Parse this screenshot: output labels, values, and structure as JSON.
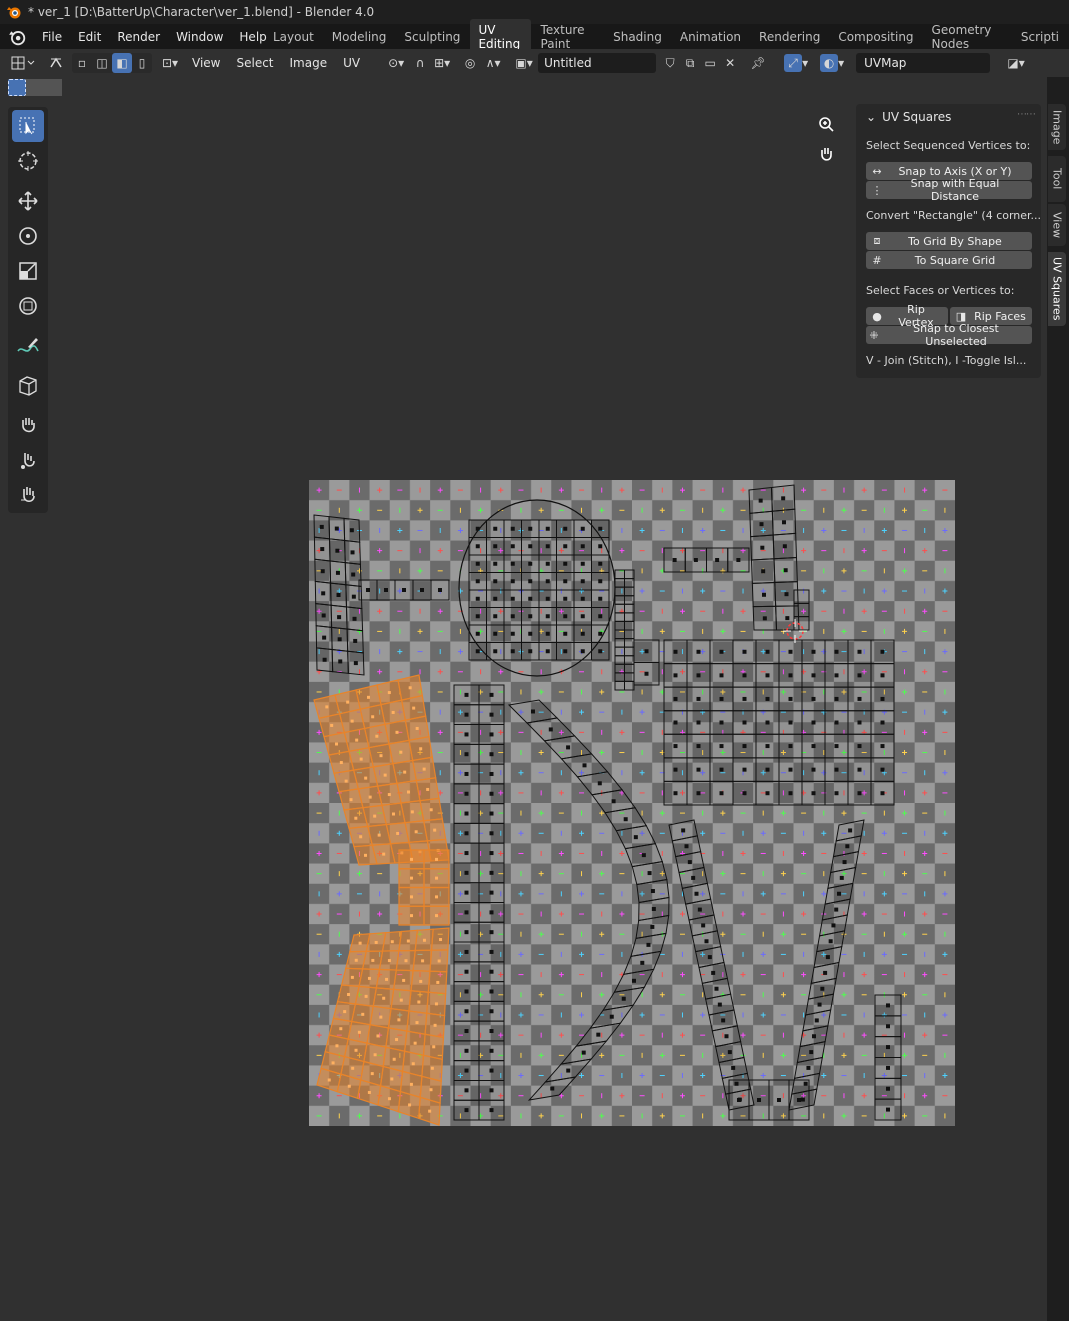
{
  "titlebar": {
    "title": "* ver_1 [D:\\BatterUp\\Character\\ver_1.blend] - Blender 4.0"
  },
  "menubar": {
    "items": [
      "File",
      "Edit",
      "Render",
      "Window",
      "Help"
    ],
    "workspaces": [
      "Layout",
      "Modeling",
      "Sculpting",
      "UV Editing",
      "Texture Paint",
      "Shading",
      "Animation",
      "Rendering",
      "Compositing",
      "Geometry Nodes",
      "Scripti"
    ],
    "active_workspace": "UV Editing"
  },
  "header": {
    "menus": [
      "View",
      "Select",
      "Image",
      "UV"
    ],
    "image_name": "Untitled",
    "uv_map": "UVMap"
  },
  "tools": [
    "select-box",
    "cursor",
    "move",
    "rotate",
    "scale",
    "transform",
    "annotate",
    "rip",
    "grab",
    "relax",
    "pinch"
  ],
  "npanel": {
    "title": "UV Squares",
    "section1": "Select Sequenced Vertices to:",
    "btn_snap_axis": "Snap to Axis (X or Y)",
    "btn_snap_equal": "Snap with Equal Distance",
    "section2": "Convert \"Rectangle\" (4 corner...",
    "btn_grid_shape": "To Grid By Shape",
    "btn_square_grid": "To Square Grid",
    "section3": "Select Faces or Vertices to:",
    "btn_rip_vertex": "Rip Vertex",
    "btn_rip_faces": "Rip Faces",
    "btn_snap_closest": "Snap to Closest Unselected",
    "hint": "V - Join (Stitch), I -Toggle Isl..."
  },
  "side_tabs": [
    "Image",
    "Tool",
    "View",
    "UV Squares"
  ],
  "active_side_tab": "UV Squares",
  "colors": {
    "accent": "#4772b3",
    "selected_uv": "#e8842a",
    "panel_bg": "#282828",
    "editor_bg": "#303030"
  }
}
